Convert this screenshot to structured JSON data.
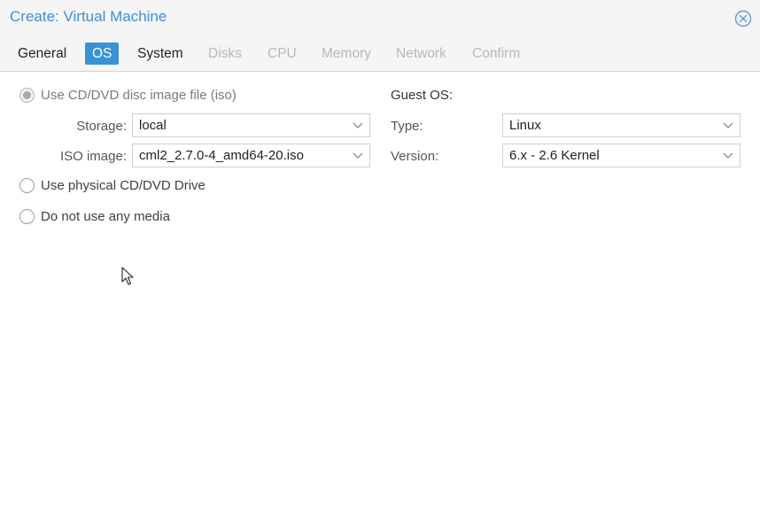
{
  "window": {
    "title": "Create: Virtual Machine"
  },
  "tabs": [
    {
      "label": "General",
      "state": "normal"
    },
    {
      "label": "OS",
      "state": "active"
    },
    {
      "label": "System",
      "state": "normal"
    },
    {
      "label": "Disks",
      "state": "disabled"
    },
    {
      "label": "CPU",
      "state": "disabled"
    },
    {
      "label": "Memory",
      "state": "disabled"
    },
    {
      "label": "Network",
      "state": "disabled"
    },
    {
      "label": "Confirm",
      "state": "disabled"
    }
  ],
  "media": {
    "options": [
      {
        "label": "Use CD/DVD disc image file (iso)",
        "checked": true
      },
      {
        "label": "Use physical CD/DVD Drive",
        "checked": false
      },
      {
        "label": "Do not use any media",
        "checked": false
      }
    ],
    "storage": {
      "label": "Storage:",
      "value": "local"
    },
    "iso": {
      "label": "ISO image:",
      "value": "cml2_2.7.0-4_amd64-20.iso"
    }
  },
  "guest_os": {
    "heading": "Guest OS:",
    "type": {
      "label": "Type:",
      "value": "Linux"
    },
    "version": {
      "label": "Version:",
      "value": "6.x - 2.6 Kernel"
    }
  },
  "colors": {
    "accent": "#3892d4",
    "title": "#3e8fd6",
    "disabled_tab": "#b8b8b8"
  },
  "icons": {
    "close": "close-circle-x-icon",
    "dropdown": "chevron-down-icon",
    "cursor": "mouse-pointer-icon"
  }
}
